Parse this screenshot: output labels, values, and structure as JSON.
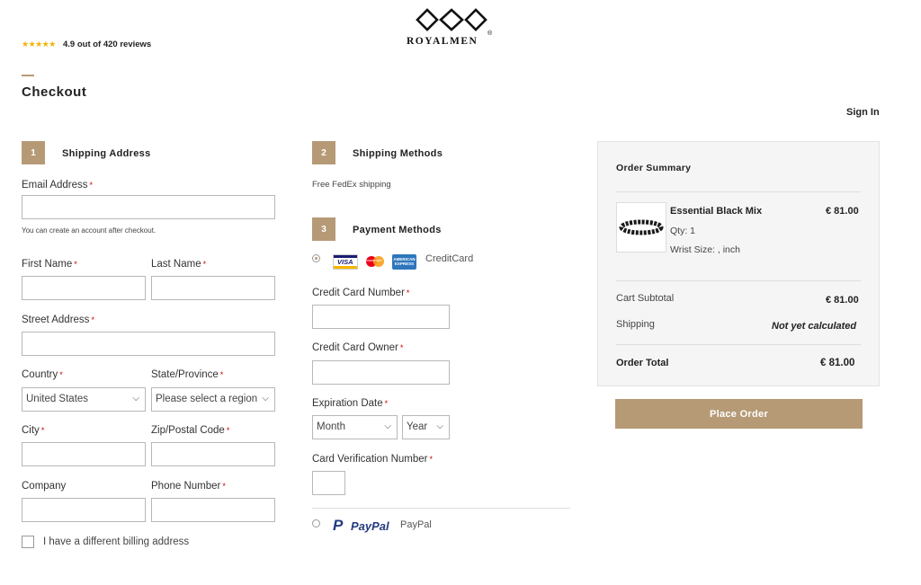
{
  "header": {
    "rating_text": "4.9 out of 420 reviews",
    "brand_name": "ROYALMEN",
    "brand_mark": "®",
    "page_title": "Checkout",
    "sign_in": "Sign In"
  },
  "shipping_address": {
    "step": "1",
    "title": "Shipping Address",
    "email_label": "Email Address",
    "email_hint": "You can create an account after checkout.",
    "first_name_label": "First Name",
    "last_name_label": "Last Name",
    "street_label": "Street Address",
    "country_label": "Country",
    "country_value": "United States",
    "state_label": "State/Province",
    "state_placeholder": "Please select a region",
    "city_label": "City",
    "zip_label": "Zip/Postal Code",
    "company_label": "Company",
    "phone_label": "Phone Number",
    "billing_checkbox": "I have a different billing address",
    "required_mark": "*"
  },
  "shipping_methods": {
    "step": "2",
    "title": "Shipping Methods",
    "method": "Free FedEx shipping"
  },
  "payment_methods": {
    "step": "3",
    "title": "Payment Methods",
    "credit_card_label": "CreditCard",
    "card_brands": [
      "VISA",
      "mastercard",
      "AMERICAN EXPRESS"
    ],
    "card_number_label": "Credit Card Number",
    "card_owner_label": "Credit Card Owner",
    "expiration_label": "Expiration Date",
    "month_value": "Month",
    "year_value": "Year",
    "cvv_label": "Card Verification Number",
    "paypal_logo": "PayPal",
    "paypal_label": "PayPal"
  },
  "order_summary": {
    "title": "Order Summary",
    "item_name": "Essential Black Mix",
    "item_price": "€ 81.00",
    "item_qty": "Qty: 1",
    "item_option": "Wrist Size: , inch",
    "subtotal_label": "Cart Subtotal",
    "subtotal_value": "€ 81.00",
    "shipping_label": "Shipping",
    "shipping_value": "Not yet calculated",
    "total_label": "Order Total",
    "total_value": "€ 81.00",
    "place_order": "Place Order"
  },
  "colors": {
    "accent": "#b69a76",
    "required": "#cc0000",
    "paypal_dark": "#253b80",
    "paypal_light": "#179bd7"
  }
}
